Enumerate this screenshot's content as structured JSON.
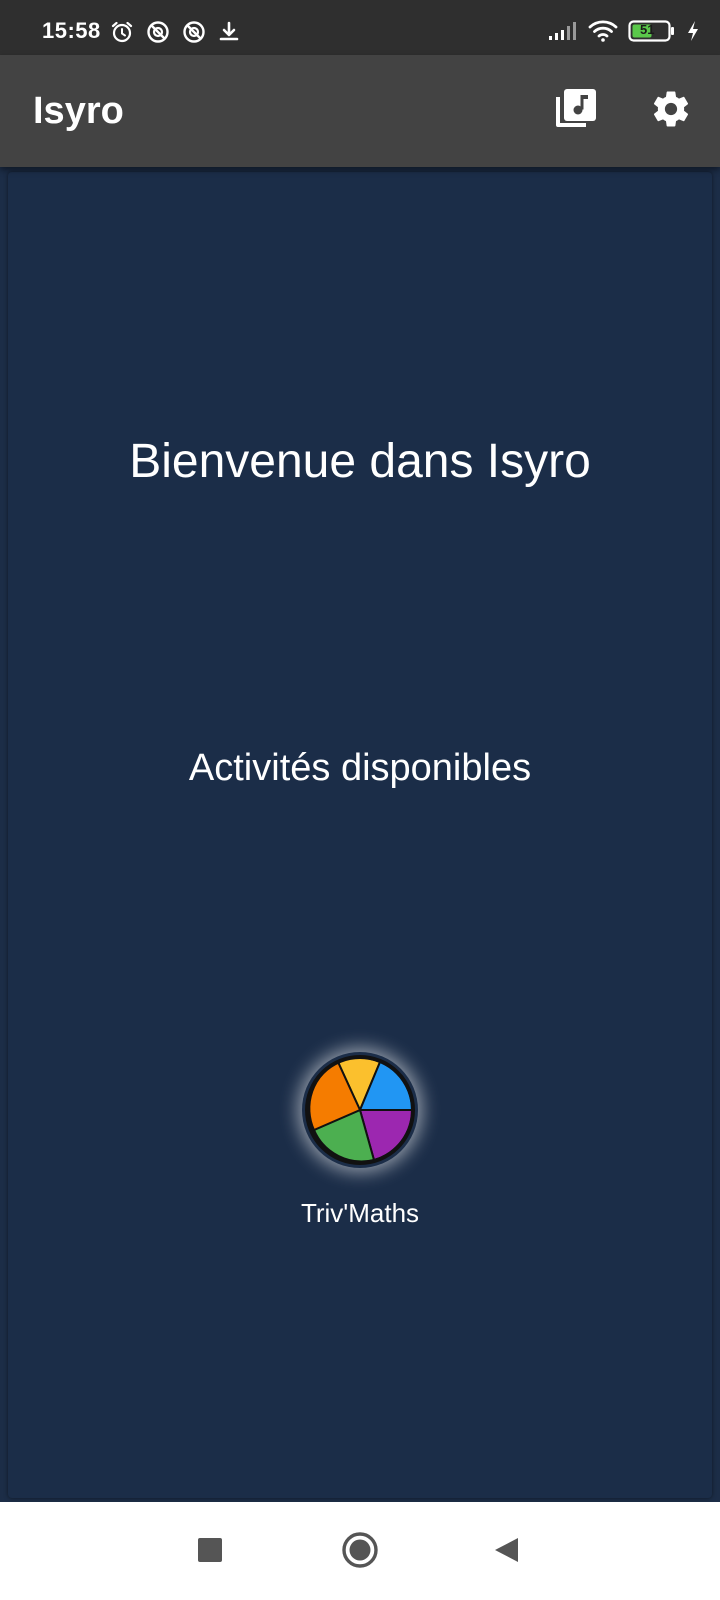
{
  "status_bar": {
    "time": "15:58",
    "battery_level": "51",
    "left_icons": [
      "alarm-icon",
      "blocked-icon",
      "blocked-icon",
      "download-icon"
    ],
    "right_icons": [
      "signal-icon",
      "wifi-icon",
      "battery-icon",
      "charging-icon"
    ]
  },
  "app_bar": {
    "title": "Isyro",
    "actions": [
      "music-library-icon",
      "gear-icon"
    ]
  },
  "main": {
    "welcome": "Bienvenue dans Isyro",
    "activities_heading": "Activités disponibles",
    "activities": [
      {
        "label": "Triv'Maths",
        "icon": "pie-wheel-icon",
        "colors": [
          "#fbc02d",
          "#2196f3",
          "#9c27b0",
          "#4caf50",
          "#f57c00"
        ]
      }
    ]
  },
  "nav_bar": {
    "buttons": [
      "recents-icon",
      "home-icon",
      "back-icon"
    ]
  },
  "colors": {
    "status_bar": "#2f2f2f",
    "app_bar": "#434343",
    "background": "#1b2d48",
    "nav_bar": "#ffffff"
  }
}
